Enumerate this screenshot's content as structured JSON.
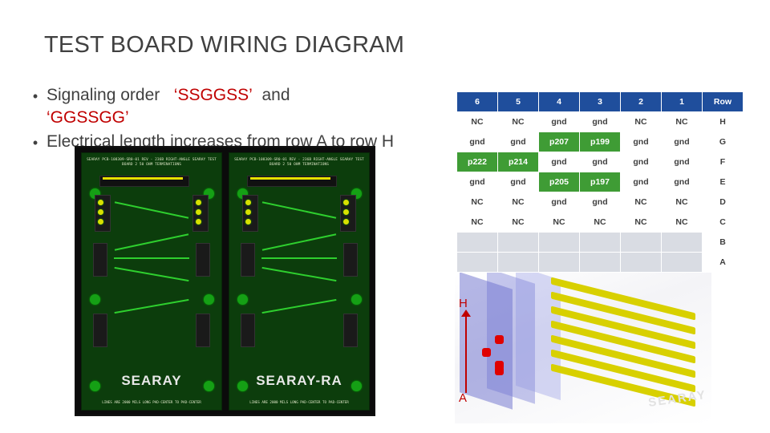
{
  "slide": {
    "title": "TEST BOARD WIRING DIAGRAM",
    "bullets": [
      {
        "marker": "•",
        "pre": "Signaling order",
        "quoted1": "‘SSGGSS’",
        "mid": "and",
        "quoted2": "‘GGSSGG’"
      },
      {
        "marker": "•",
        "text": "Electrical length increases from row A to row H"
      }
    ]
  },
  "table": {
    "headers": [
      "6",
      "5",
      "4",
      "3",
      "2",
      "1",
      "Row"
    ],
    "rows": [
      {
        "cells": [
          "NC",
          "NC",
          "gnd",
          "gnd",
          "NC",
          "NC"
        ],
        "states": [
          "white",
          "white",
          "white",
          "white",
          "white",
          "white"
        ],
        "row": "H"
      },
      {
        "cells": [
          "gnd",
          "gnd",
          "p207",
          "p199",
          "gnd",
          "gnd"
        ],
        "states": [
          "white",
          "white",
          "green",
          "green",
          "white",
          "white"
        ],
        "row": "G"
      },
      {
        "cells": [
          "p222",
          "p214",
          "gnd",
          "gnd",
          "gnd",
          "gnd"
        ],
        "states": [
          "green",
          "green",
          "white",
          "white",
          "white",
          "white"
        ],
        "row": "F"
      },
      {
        "cells": [
          "gnd",
          "gnd",
          "p205",
          "p197",
          "gnd",
          "gnd"
        ],
        "states": [
          "white",
          "white",
          "green",
          "green",
          "white",
          "white"
        ],
        "row": "E"
      },
      {
        "cells": [
          "NC",
          "NC",
          "gnd",
          "gnd",
          "NC",
          "NC"
        ],
        "states": [
          "white",
          "white",
          "white",
          "white",
          "white",
          "white"
        ],
        "row": "D"
      },
      {
        "cells": [
          "NC",
          "NC",
          "NC",
          "NC",
          "NC",
          "NC"
        ],
        "states": [
          "white",
          "white",
          "white",
          "white",
          "white",
          "white"
        ],
        "row": "C"
      },
      {
        "cells": [
          "",
          "",
          "",
          "",
          "",
          ""
        ],
        "states": [
          "empty",
          "empty",
          "empty",
          "empty",
          "empty",
          "empty"
        ],
        "row": "B"
      },
      {
        "cells": [
          "",
          "",
          "",
          "",
          "",
          ""
        ],
        "states": [
          "empty",
          "empty",
          "empty",
          "empty",
          "empty",
          "empty"
        ],
        "row": "A"
      }
    ]
  },
  "board_photo": {
    "left_board": {
      "silk": "SEARAY   PCB-108309-SR0-01 REV -\n236B RIGHT-ANGLE SEARAY TEST BOARD 2\n50 OHM TERMINATIONS",
      "brand": "SEARAY",
      "bottom": "LINES ARE 2000 MILS LONG\nPAD-CENTER TO PAD-CENTER"
    },
    "right_board": {
      "silk": "SEARAY   PCB-108309-SR0-01 REV -\n236B RIGHT-ANGLE SEARAY TEST BOARD 2\n50 OHM TERMINATIONS",
      "brand": "SEARAY-RA",
      "bottom": "LINES ARE 2000 MILS LONG\nPAD-CENTER TO PAD-CENTER"
    }
  },
  "arrow": {
    "top_label": "H",
    "bottom_label": "A"
  },
  "colors": {
    "header_blue": "#1f4e9c",
    "cell_green": "#3f9c35",
    "accent_red": "#c00000",
    "empty_gray": "#d9dce3"
  }
}
